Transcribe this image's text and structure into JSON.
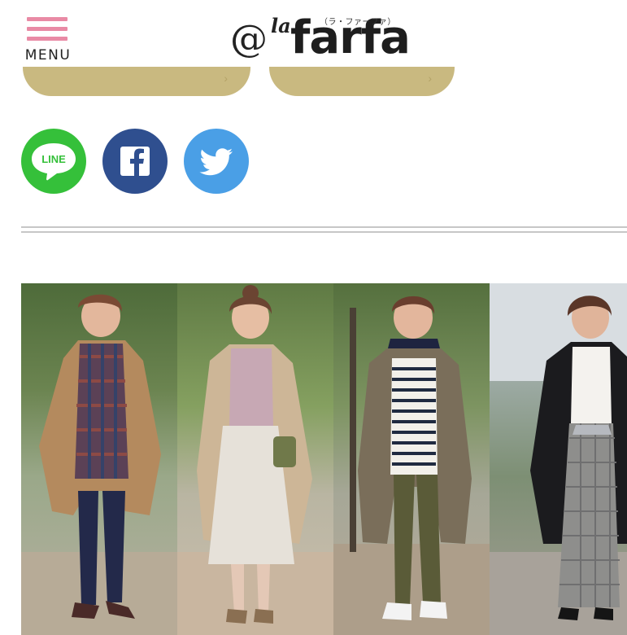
{
  "header": {
    "menu_label": "MENU",
    "logo": {
      "at": "@",
      "la": "la",
      "name": "farfa",
      "reading": "（ラ・ファーファ）"
    }
  },
  "buttons": [
    {
      "id": "pill-1",
      "label": ""
    },
    {
      "id": "pill-2",
      "label": ""
    }
  ],
  "share": {
    "line_label": "LINE",
    "facebook_glyph": "f",
    "twitter_icon": "bird"
  },
  "colors": {
    "menu_pink": "#e98aa5",
    "pill_gold": "#c9b980",
    "line_green": "#35c03a",
    "facebook_blue": "#2f4f8f",
    "twitter_blue": "#4a9fe6",
    "divider_gray": "#c7c7c7"
  },
  "hero_image": {
    "panels": 4,
    "outfits": [
      {
        "coat": "quilted beige coat",
        "top": "plaid tunic",
        "bottom": "navy pants"
      },
      {
        "coat": "beige long coat",
        "top": "lavender knit",
        "bottom": "pleated cream skirt"
      },
      {
        "coat": "olive hooded coat",
        "top": "striped top with navy snood",
        "bottom": "olive pants"
      },
      {
        "coat": "black long cardigan",
        "top": "white top",
        "bottom": "gray check wide pants"
      }
    ]
  }
}
